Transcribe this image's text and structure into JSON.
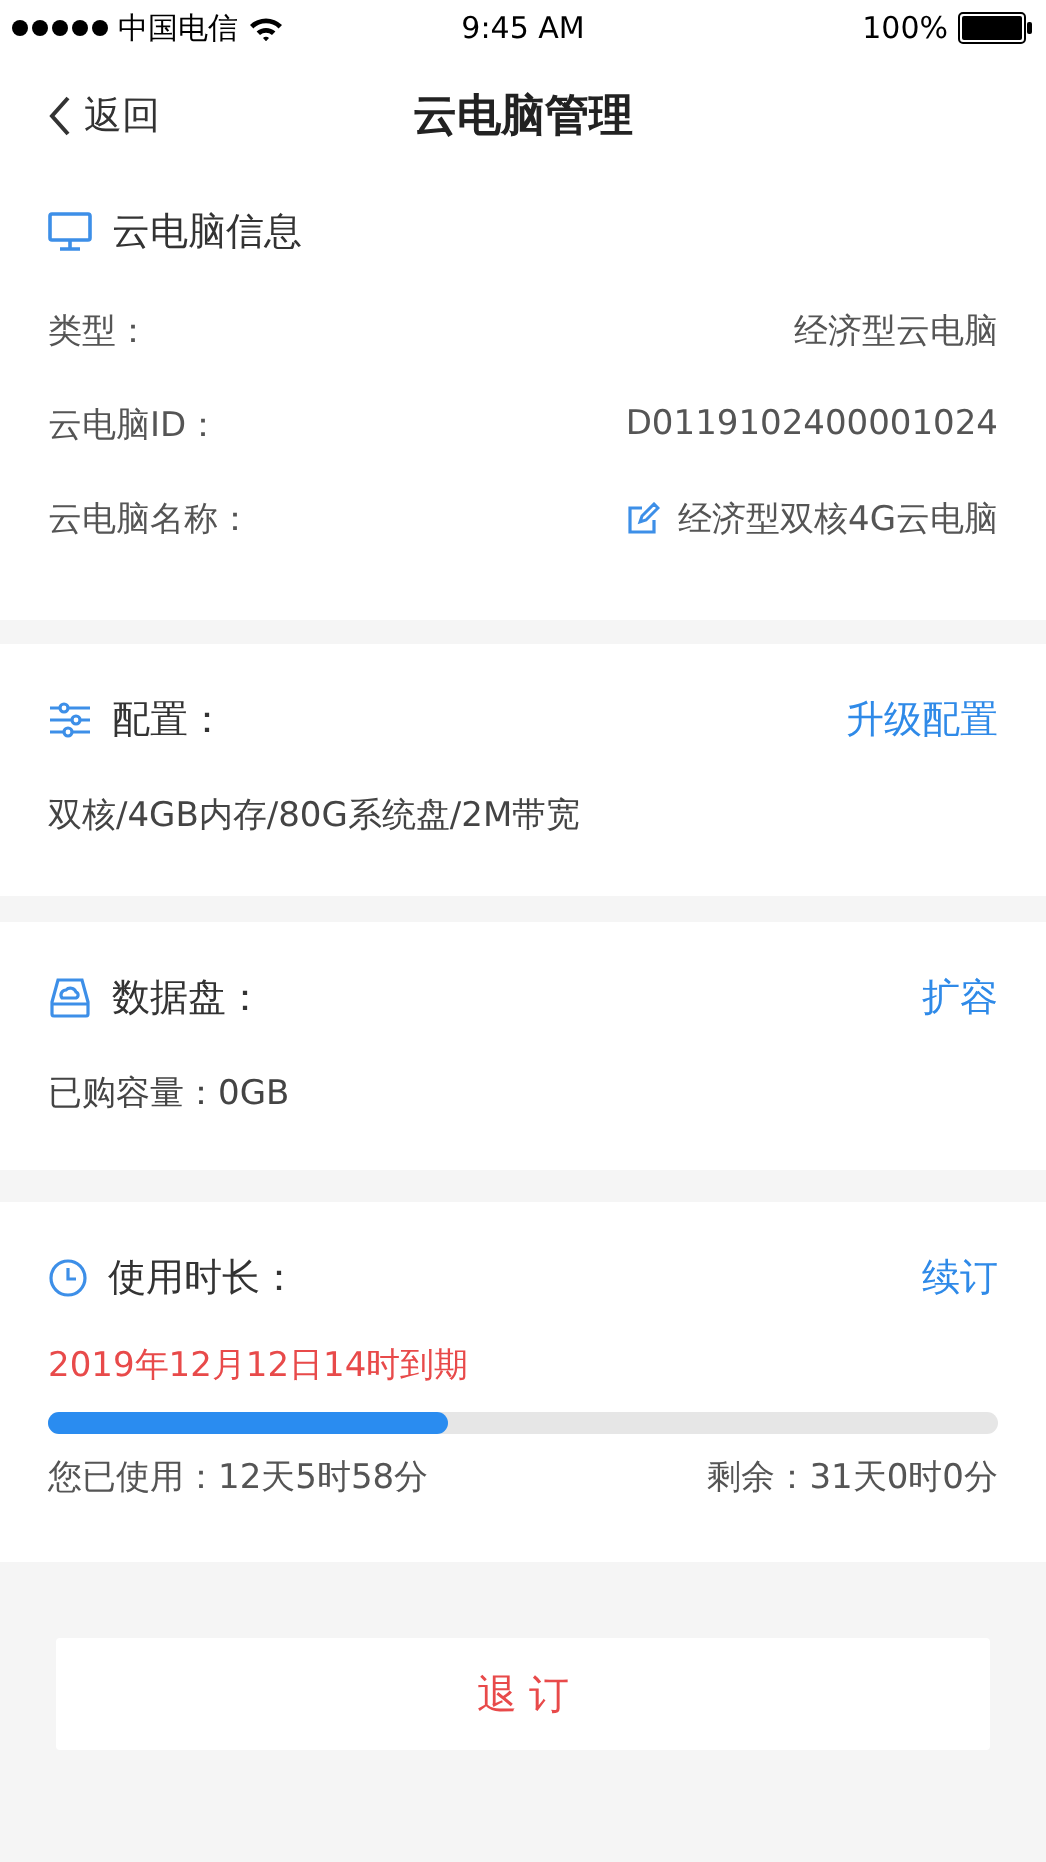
{
  "status_bar": {
    "carrier": "中国电信",
    "time": "9:45 AM",
    "battery": "100%"
  },
  "nav": {
    "back": "返回",
    "title": "云电脑管理"
  },
  "info": {
    "title": "云电脑信息",
    "rows": [
      {
        "label": "类型：",
        "value": "经济型云电脑",
        "editable": false
      },
      {
        "label": "云电脑ID：",
        "value": "D0119102400001024",
        "editable": false
      },
      {
        "label": "云电脑名称：",
        "value": "经济型双核4G云电脑",
        "editable": true
      }
    ]
  },
  "config": {
    "title": "配置：",
    "action": "升级配置",
    "text": "双核/4GB内存/80G系统盘/2M带宽"
  },
  "disk": {
    "title": "数据盘：",
    "action": "扩容",
    "text": "已购容量：0GB"
  },
  "usage": {
    "title": "使用时长：",
    "action": "续订",
    "expiry": "2019年12月12日14时到期",
    "level": 0.42,
    "used": "您已使用：12天5时58分",
    "remaining": "剩余：31天0时0分"
  },
  "cancel_button": "退 订"
}
